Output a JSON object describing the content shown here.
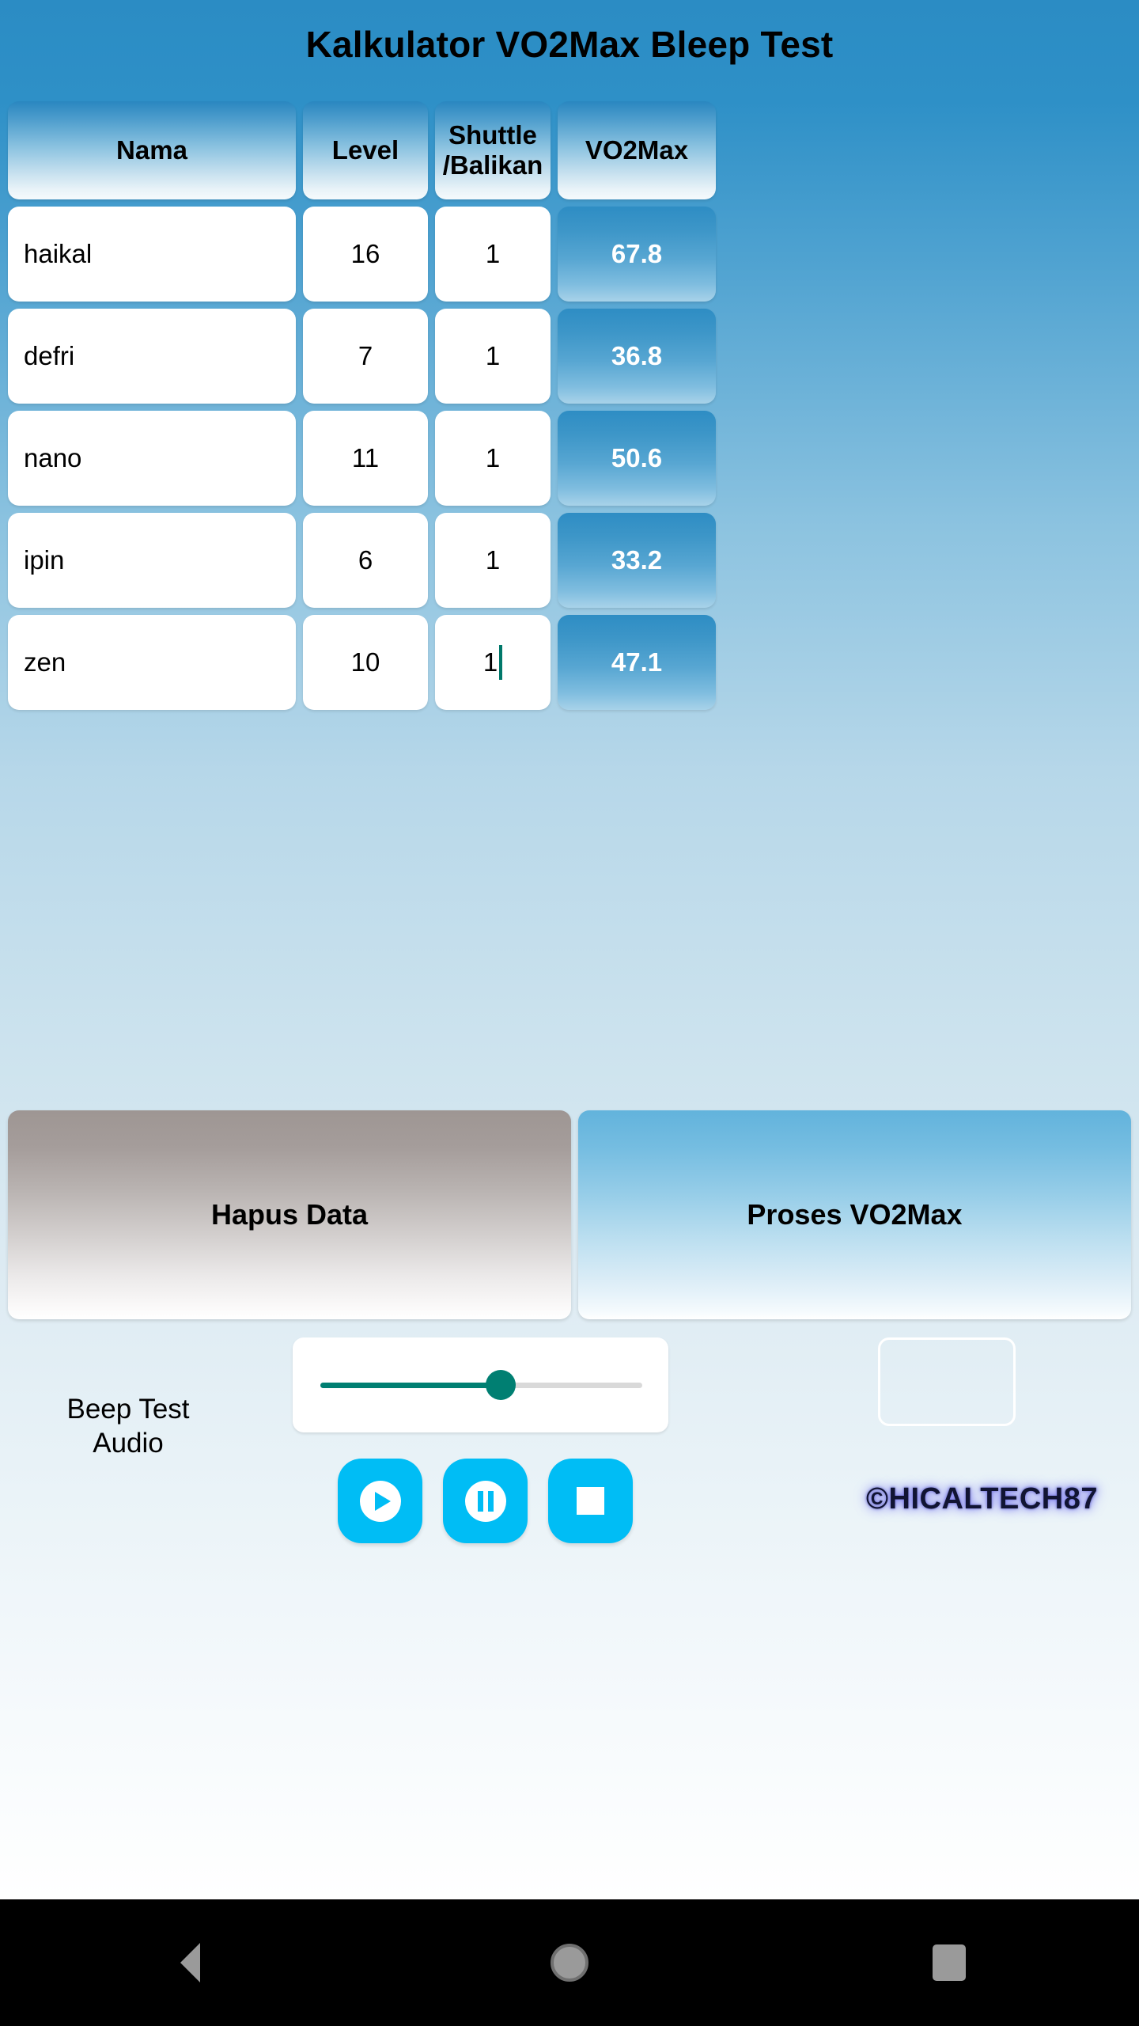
{
  "app": {
    "title": "Kalkulator VO2Max Bleep Test"
  },
  "table": {
    "headers": {
      "nama": "Nama",
      "level": "Level",
      "shuttle_line1": "Shuttle",
      "shuttle_line2": "/Balikan",
      "vo2max": "VO2Max"
    },
    "rows": [
      {
        "nama": "haikal",
        "level": "16",
        "shuttle": "1",
        "vo2max": "67.8",
        "focused": false
      },
      {
        "nama": "defri",
        "level": "7",
        "shuttle": "1",
        "vo2max": "36.8",
        "focused": false
      },
      {
        "nama": "nano",
        "level": "11",
        "shuttle": "1",
        "vo2max": "50.6",
        "focused": false
      },
      {
        "nama": "ipin",
        "level": "6",
        "shuttle": "1",
        "vo2max": "33.2",
        "focused": false
      },
      {
        "nama": "zen",
        "level": "10",
        "shuttle": "1",
        "vo2max": "47.1",
        "focused": true
      }
    ]
  },
  "actions": {
    "hapus_label": "Hapus Data",
    "proses_label": "Proses VO2Max"
  },
  "audio": {
    "label_line1": "Beep Test",
    "label_line2": "Audio",
    "slider_value_percent": 56,
    "play_icon": "play-icon",
    "pause_icon": "pause-icon",
    "stop_icon": "stop-icon",
    "extra_field_value": ""
  },
  "watermark": {
    "text": "©HICALTECH87"
  },
  "navbar": {
    "back_icon": "back-triangle-icon",
    "home_icon": "home-circle-icon",
    "recents_icon": "recents-square-icon"
  },
  "colors": {
    "header_blue": "#2986c0",
    "vo2_cell_blue": "#2e8dc4",
    "media_button_cyan": "#00bdf5",
    "slider_teal": "#007f72",
    "caret_teal": "#00786a"
  }
}
